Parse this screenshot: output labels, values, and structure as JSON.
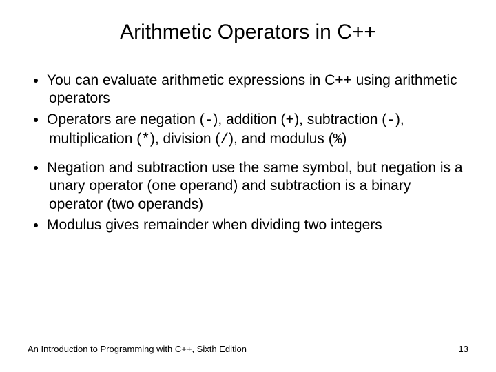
{
  "title": "Arithmetic Operators in C++",
  "bullets": {
    "b1": "You can evaluate arithmetic expressions in C++ using arithmetic operators",
    "b2": {
      "t1": "Operators are negation (",
      "op1": "-",
      "t2": "), addition (",
      "op2": "+",
      "t3": "), subtraction (",
      "op3": "-",
      "t4": "), multiplication (",
      "op4": "*",
      "t5": "), division (",
      "op5": "/",
      "t6": "), and modulus (",
      "op6": "%",
      "t7": ")"
    },
    "b3": "Negation and subtraction use the same symbol, but negation is a unary operator (one operand) and subtraction is a binary operator (two operands)",
    "b4": "Modulus gives remainder when dividing two integers"
  },
  "footer": {
    "source": "An Introduction to Programming with C++, Sixth Edition",
    "page": "13"
  }
}
